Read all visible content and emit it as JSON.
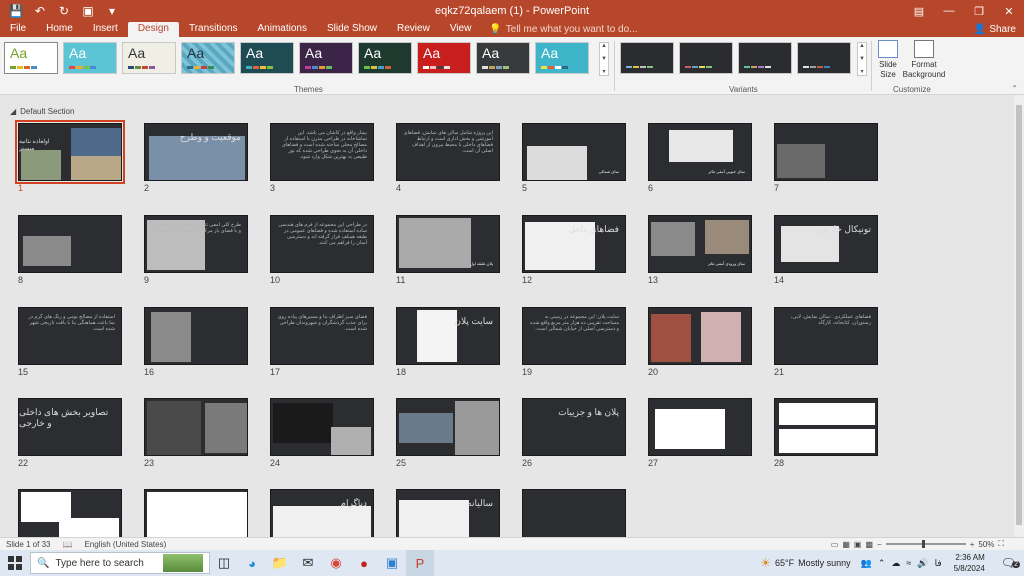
{
  "window": {
    "title": "eqkz72qalaem (1) - PowerPoint"
  },
  "tabs": [
    "File",
    "Home",
    "Insert",
    "Design",
    "Transitions",
    "Animations",
    "Slide Show",
    "Review",
    "View"
  ],
  "active_tab": "Design",
  "tell_me": "Tell me what you want to do...",
  "share_label": "Share",
  "ribbon": {
    "themes_label": "Themes",
    "variants_label": "Variants",
    "customize_label": "Customize",
    "slide_size_label": "Slide Size",
    "format_background_label": "Format Background",
    "theme_glyph": "Aa"
  },
  "section_name": "Default Section",
  "slides": [
    {
      "num": "1",
      "head": "اولعاده نئانیه مبستر"
    },
    {
      "num": "2",
      "head": "موقعیت و وطرح"
    },
    {
      "num": "3",
      "text": "بیمار واقع در کاشان می باشد. این تماشاخانه در طراحی مدرن با استفاده از مصالح محلی ساخته شده است و فضاهای داخلی آن به نحوی طراحی شده که نور طبیعی به بهترین شکل وارد شود."
    },
    {
      "num": "4",
      "text": "این پروژه شامل سالن های نمایش، فضاهای آموزشی و بخش اداری است و ارتباط فضاهای داخلی با محیط بیرون از اهداف اصلی آن است."
    },
    {
      "num": "5",
      "sub": "نمای شمالی"
    },
    {
      "num": "6",
      "sub": "نمای جنوبی آمفی تئاتر"
    },
    {
      "num": "7"
    },
    {
      "num": "8"
    },
    {
      "num": "9",
      "text": "طرح کلی آمفی تئاتر: ساختمان در سه طبقه و با فضای باز مرکزی طراحی شده است."
    },
    {
      "num": "10",
      "text": "در طراحی این مجموعه از فرم های هندسی ساده استفاده شده و فضاهای عمومی در طبقه همکف قرار گرفته اند و دسترسی آسان را فراهم می کنند."
    },
    {
      "num": "11",
      "sub": "پلان طبقه اول"
    },
    {
      "num": "12",
      "head": "فضاهای داخل"
    },
    {
      "num": "13",
      "sub": "نمای ورودی آمفی تئاتر"
    },
    {
      "num": "14",
      "head": "تونیکال خارجی"
    },
    {
      "num": "15",
      "text": "استفاده از مصالح بومی و رنگ های گرم در نما باعث هماهنگی بنا با بافت تاریخی شهر شده است."
    },
    {
      "num": "16"
    },
    {
      "num": "17",
      "text": "فضای سبز اطراف بنا و مسیرهای پیاده روی برای جذب گردشگران و شهروندان طراحی شده است."
    },
    {
      "num": "18",
      "head": "سایت پلان"
    },
    {
      "num": "19",
      "text": "سایت پلان: این مجموعه در زمینی به مساحت تقریبی ده هزار متر مربع واقع شده و دسترسی اصلی از خیابان شمالی است."
    },
    {
      "num": "20"
    },
    {
      "num": "21",
      "text": "فضاهای عملکردی : سالن نمایش، لابی، رستوران، کتابخانه، کارگاه"
    },
    {
      "num": "22",
      "head": "تصاویر بخش های داخلی و خارجی"
    },
    {
      "num": "23"
    },
    {
      "num": "24"
    },
    {
      "num": "25"
    },
    {
      "num": "26",
      "head": "پلان ها و جزییات"
    },
    {
      "num": "27"
    },
    {
      "num": "28"
    },
    {
      "num": "29"
    },
    {
      "num": "30"
    },
    {
      "num": "31",
      "head": "دیاگرام"
    },
    {
      "num": "32",
      "head": "سالیانه"
    },
    {
      "num": "33"
    }
  ],
  "status": {
    "slide_info": "Slide 1 of 33",
    "language": "English (United States)",
    "zoom": "50%"
  },
  "taskbar": {
    "search_placeholder": "Type here to search",
    "weather_temp": "65°F",
    "weather_text": "Mostly sunny",
    "lang": "فا",
    "time": "2:36 AM",
    "date": "5/8/2024",
    "notif_count": "2"
  },
  "colors": {
    "accent": "#b7472a",
    "selection": "#d04423",
    "slide_bg": "#2b2d30"
  }
}
